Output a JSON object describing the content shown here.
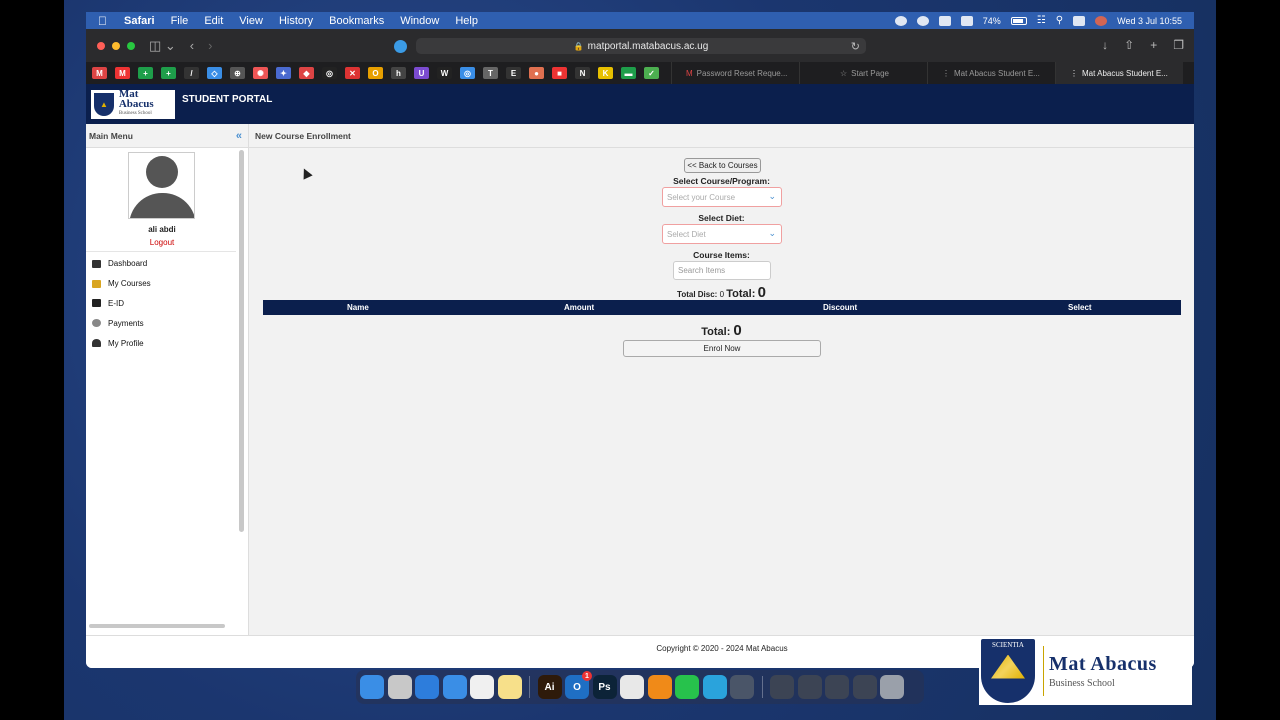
{
  "menubar": {
    "app": "Safari",
    "items": [
      "File",
      "Edit",
      "View",
      "History",
      "Bookmarks",
      "Window",
      "Help"
    ],
    "battery": "74%",
    "clock": "Wed 3 Jul  10:55"
  },
  "browser": {
    "url": "matportal.matabacus.ac.ug",
    "tabs": [
      {
        "label": "Password Reset Reque..."
      },
      {
        "label": "Start Page"
      },
      {
        "label": "Mat Abacus Student E..."
      },
      {
        "label": "Mat Abacus Student E..."
      }
    ],
    "favorites": [
      "M",
      "M",
      "+",
      "+",
      "/",
      "◇",
      "⊕",
      "✺",
      "✦",
      "◆",
      "◎",
      "✕",
      "O",
      "h",
      "U",
      "W",
      "◎",
      "T",
      "E",
      "●",
      "■",
      "N",
      "K",
      "▬",
      "✓"
    ]
  },
  "portal": {
    "logo_name": "Mat Abacus",
    "logo_sub": "Business School",
    "title": "STUDENT PORTAL"
  },
  "sidebar": {
    "header": "Main Menu",
    "user_name": "ali abdi",
    "logout": "Logout",
    "items": [
      {
        "label": "Dashboard",
        "icon": "dashboard-icon",
        "color": "#333333"
      },
      {
        "label": "My Courses",
        "icon": "courses-icon",
        "color": "#d9a520"
      },
      {
        "label": "E-ID",
        "icon": "id-card-icon",
        "color": "#222222"
      },
      {
        "label": "Payments",
        "icon": "payments-icon",
        "color": "#888888"
      },
      {
        "label": "My Profile",
        "icon": "profile-icon",
        "color": "#333333"
      }
    ]
  },
  "content": {
    "header": "New Course Enrollment",
    "back_button": "<< Back to Courses",
    "course_label": "Select Course/Program:",
    "course_placeholder": "Select your Course",
    "diet_label": "Select Diet:",
    "diet_placeholder": "Select Diet",
    "items_label": "Course Items:",
    "search_placeholder": "Search Items",
    "total_disc_label": "Total Disc:",
    "total_disc_value": "0",
    "total_label": "Total:",
    "total_value": "0",
    "table_columns": [
      "Name",
      "Amount",
      "Discount",
      "Select"
    ],
    "total2_label": "Total:",
    "total2_value": "0",
    "enrol_button": "Enrol Now"
  },
  "footer": {
    "copyright": "Copyright © 2020 - 2024 Mat Abacus"
  },
  "brand": {
    "motto": "SCIENTIA",
    "name": "Mat Abacus",
    "sub": "Business School"
  },
  "dock": {
    "apps": [
      {
        "icon": "finder-icon",
        "color": "#3a8ee6",
        "glyph": ""
      },
      {
        "icon": "launchpad-icon",
        "color": "#c8c8c8",
        "glyph": ""
      },
      {
        "icon": "safari-icon",
        "color": "#2d7ddc",
        "glyph": ""
      },
      {
        "icon": "mail-icon",
        "color": "#3a8ee6",
        "glyph": ""
      },
      {
        "icon": "reminders-icon",
        "color": "#f0f0f0",
        "glyph": ""
      },
      {
        "icon": "notes-icon",
        "color": "#f7e08a",
        "glyph": ""
      },
      {
        "icon": "illustrator-icon",
        "color": "#2e1a0a",
        "glyph": "Ai"
      },
      {
        "icon": "outlook-icon",
        "color": "#1f6fc4",
        "glyph": "O"
      },
      {
        "icon": "photoshop-icon",
        "color": "#0c2338",
        "glyph": "Ps"
      },
      {
        "icon": "chrome-icon",
        "color": "#e8e8e8",
        "glyph": ""
      },
      {
        "icon": "vlc-icon",
        "color": "#f08a18",
        "glyph": ""
      },
      {
        "icon": "whatsapp-icon",
        "color": "#27c24c",
        "glyph": ""
      },
      {
        "icon": "telegram-icon",
        "color": "#2aa3dc",
        "glyph": ""
      },
      {
        "icon": "quicktime-icon",
        "color": "#4a5568",
        "glyph": ""
      }
    ],
    "outlook_badge": "1"
  }
}
